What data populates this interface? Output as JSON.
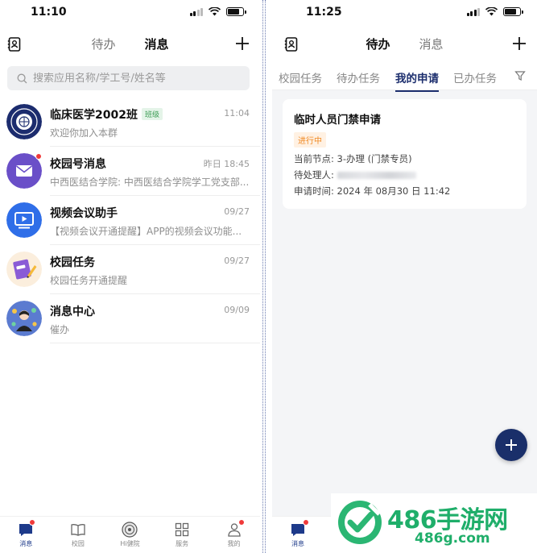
{
  "left": {
    "status_time": "11:10",
    "tabs": [
      "待办",
      "消息"
    ],
    "active_tab": "消息",
    "search_placeholder": "搜索应用名称/学工号/姓名等",
    "messages": [
      {
        "title": "临床医学2002班",
        "badge": "班级",
        "time": "11:04",
        "subtitle": "欢迎你加入本群"
      },
      {
        "title": "校园号消息",
        "time": "昨日 18:45",
        "subtitle": "中西医结合学院: 中西医结合学院学工党支部..."
      },
      {
        "title": "视频会议助手",
        "time": "09/27",
        "subtitle": "【视频会议开通提醒】APP的视频会议功能..."
      },
      {
        "title": "校园任务",
        "time": "09/27",
        "subtitle": "校园任务开通提醒"
      },
      {
        "title": "消息中心",
        "time": "09/09",
        "subtitle": "催办"
      }
    ],
    "nav": [
      "消息",
      "校园",
      "Hi健院",
      "服务",
      "我的"
    ]
  },
  "right": {
    "status_time": "11:25",
    "tabs": [
      "待办",
      "消息"
    ],
    "active_tab": "待办",
    "subtabs": [
      "校园任务",
      "待办任务",
      "我的申请",
      "已办任务"
    ],
    "active_subtab": "我的申请",
    "card": {
      "title": "临时人员门禁申请",
      "status": "进行中",
      "node_label": "当前节点:",
      "node_value": "3-办理 (门禁专员)",
      "handler_label": "待处理人:",
      "time_label": "申请时间:",
      "time_value": "2024 年 08月30 日 11:42"
    },
    "nav": [
      "消息"
    ]
  },
  "watermark": {
    "big": "486手游网",
    "small": "486g.com"
  },
  "colors": {
    "accent": "#1d2f6e",
    "unread": "#f03a3a",
    "status_orange": "#f08a24",
    "watermark_green": "#1fae6a"
  }
}
